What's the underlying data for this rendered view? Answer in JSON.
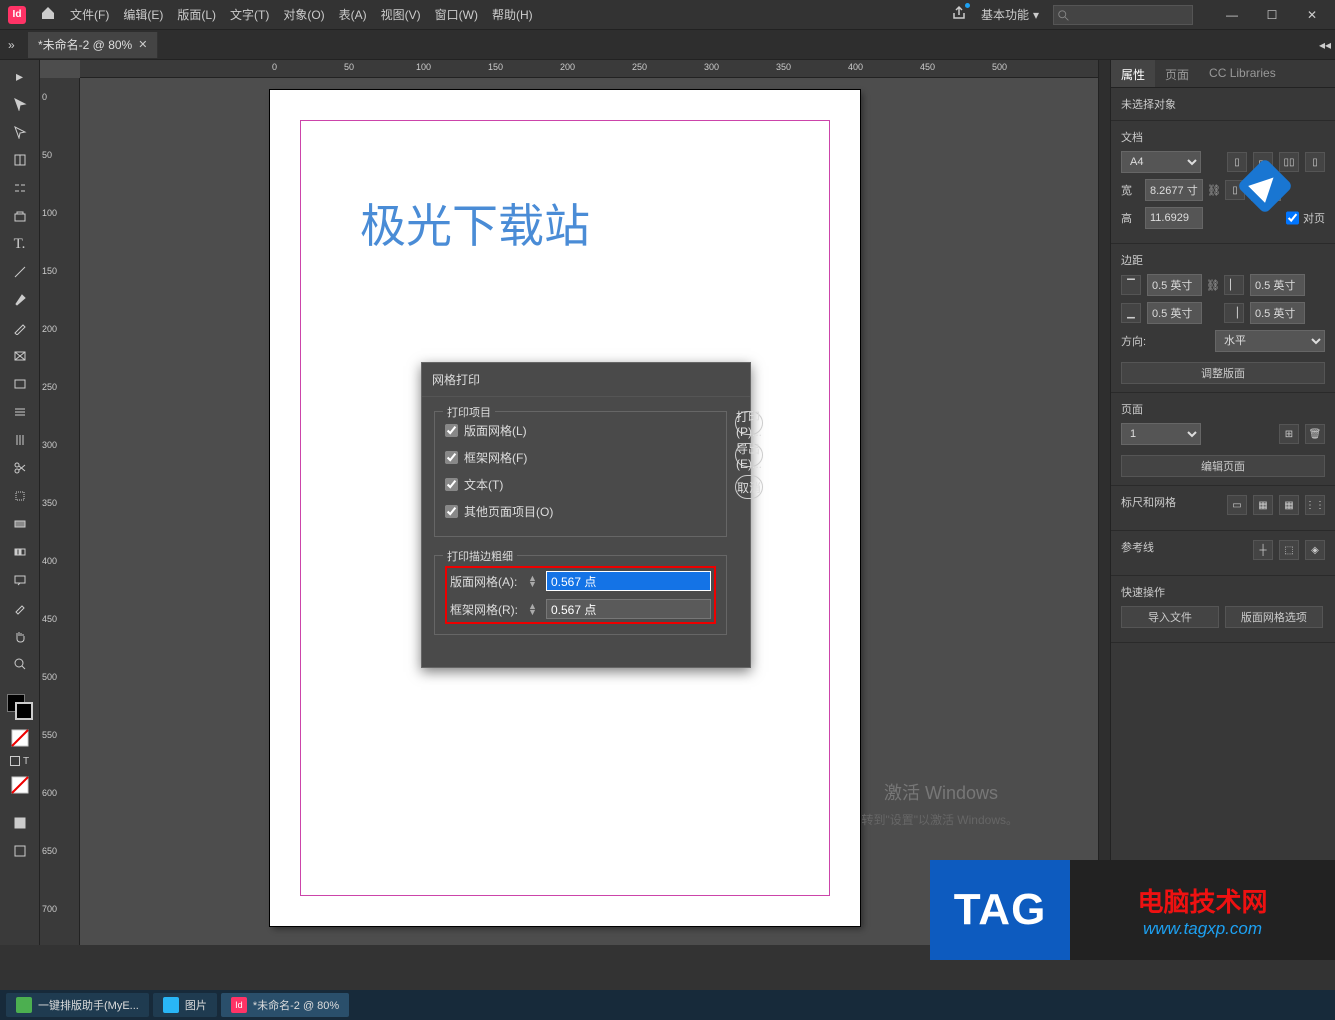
{
  "menubar": {
    "app_label": "Id",
    "items": [
      "文件(F)",
      "编辑(E)",
      "版面(L)",
      "文字(T)",
      "对象(O)",
      "表(A)",
      "视图(V)",
      "窗口(W)",
      "帮助(H)"
    ],
    "workspace": "基本功能"
  },
  "doc_tab": {
    "label": "*未命名-2 @ 80%"
  },
  "page_text": "极光下载站",
  "ruler_h": [
    "0",
    "50",
    "100",
    "150",
    "200",
    "250",
    "300",
    "350",
    "400",
    "450",
    "500"
  ],
  "ruler_v": [
    "0",
    "50",
    "100",
    "150",
    "200",
    "250",
    "300",
    "350",
    "400",
    "450",
    "500",
    "550",
    "600",
    "650",
    "700"
  ],
  "dialog": {
    "title": "网格打印",
    "group1_legend": "打印项目",
    "cb1": "版面网格(L)",
    "cb2": "框架网格(F)",
    "cb3": "文本(T)",
    "cb4": "其他页面项目(O)",
    "group2_legend": "打印描边粗细",
    "row1_label": "版面网格(A):",
    "row1_value": "0.567 点",
    "row2_label": "框架网格(R):",
    "row2_value": "0.567 点",
    "btn1": "打印(P)...",
    "btn2": "导出(E)...",
    "btn3": "取消"
  },
  "panels": {
    "tabs": [
      "属性",
      "页面",
      "CC Libraries"
    ],
    "no_selection": "未选择对象",
    "doc_section": "文档",
    "preset": "A4",
    "width_label": "宽",
    "width_value": "8.2677 寸",
    "height_label": "高",
    "height_value": "11.6929",
    "facing_label": "对页",
    "margin_section": "边距",
    "margin_top": "0.5 英寸",
    "margin_bottom": "0.5 英寸",
    "margin_left": "0.5 英寸",
    "margin_right": "0.5 英寸",
    "orient_label": "方向:",
    "orient_value": "水平",
    "adjust_btn": "调整版面",
    "page_section": "页面",
    "page_value": "1",
    "edit_pages_btn": "编辑页面",
    "ruler_section": "标尺和网格",
    "guides_section": "参考线",
    "quick_section": "快速操作",
    "import_btn": "导入文件",
    "grid_btn": "版面网格选项"
  },
  "watermark": {
    "l1": "激活 Windows",
    "l2": "转到\"设置\"以激活 Windows。"
  },
  "tag": {
    "tag": "TAG",
    "l1": "电脑技术网",
    "l2": "www.tagxp.com"
  },
  "taskbar": {
    "items": [
      {
        "label": "一键排版助手(MyE...",
        "color": "#4caf50"
      },
      {
        "label": "图片",
        "color": "#29b6f6"
      },
      {
        "label": "*未命名-2 @ 80%",
        "color": "#ff3366",
        "active": true
      }
    ]
  }
}
